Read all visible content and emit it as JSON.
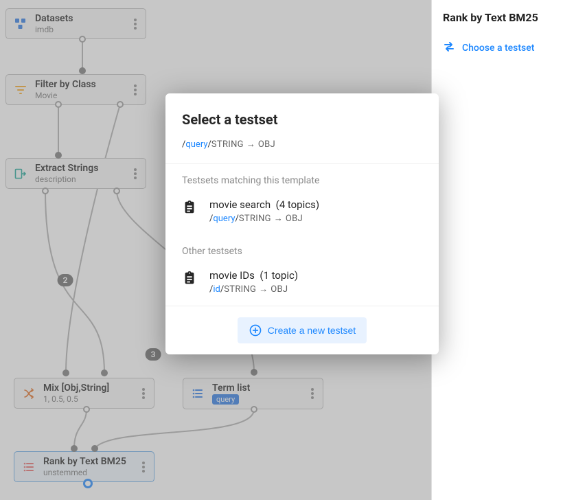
{
  "canvas": {
    "nodes": [
      {
        "id": "n0",
        "title": "Datasets",
        "sub": "imdb"
      },
      {
        "id": "n1",
        "title": "Filter by Class",
        "sub": "Movie"
      },
      {
        "id": "n2",
        "title": "Extract Strings",
        "sub": "description"
      },
      {
        "id": "n3",
        "title": "Mix [Obj,String]",
        "sub": "1, 0.5, 0.5"
      },
      {
        "id": "n4",
        "title": "Term list",
        "sub_chip": "query"
      },
      {
        "id": "n5",
        "title": "Rank by Text BM25",
        "sub": "unstemmed"
      }
    ],
    "edge_badges": {
      "b2": "2",
      "b3": "3"
    }
  },
  "sidebar": {
    "title": "Rank by Text BM25",
    "choose_label": "Choose a testset"
  },
  "modal": {
    "title": "Select a testset",
    "template": {
      "slash1": "/",
      "kw": "query",
      "slash2": "/",
      "ty": "STRING",
      "arr": "→",
      "rhs": "OBJ"
    },
    "section_matching": "Testsets matching this template",
    "matching": [
      {
        "name": "movie search",
        "topics": "(4 topics)",
        "template": {
          "slash1": "/",
          "kw": "query",
          "slash2": "/",
          "ty": "STRING",
          "arr": "→",
          "rhs": "OBJ"
        }
      }
    ],
    "section_other": "Other testsets",
    "other": [
      {
        "name": "movie IDs",
        "topics": "(1 topic)",
        "template": {
          "slash1": "/",
          "kw": "id",
          "slash2": "/",
          "ty": "STRING",
          "arr": "→",
          "rhs": "OBJ"
        }
      }
    ],
    "create_label": "Create a new testset"
  }
}
